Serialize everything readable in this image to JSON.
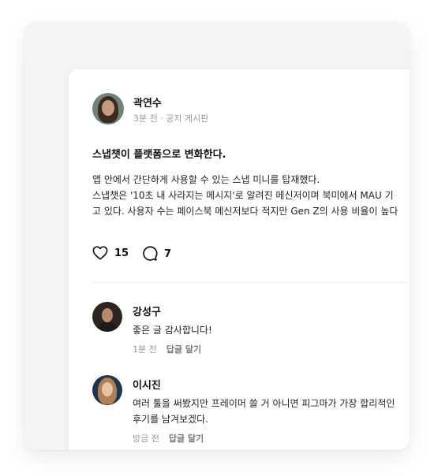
{
  "post": {
    "author": "곽연수",
    "meta": "3분 전 · 공지 게시판",
    "title": "스냅챗이 플랫폼으로 변화한다.",
    "body_lines": [
      "앱 안에서 간단하게 사용할 수 있는 스냅 미니를 탑재했다.",
      "스냅챗은 '10초 내 사라지는 메시지'로 알려진 메신저이며 북미에서 MAU 기",
      "고 있다. 사용자 수는 페이스북 메신저보다 적지만 Gen Z의 사용 비율이 높다"
    ],
    "likes": "15",
    "comments_count": "7"
  },
  "comments": [
    {
      "name": "강성구",
      "lines": [
        "좋은 글 감사합니다!"
      ],
      "time": "1분 전",
      "reply": "답글 달기"
    },
    {
      "name": "이시진",
      "lines": [
        "여러 툴을 써봤지만 프레이머 쓸 거 아니면 피그마가 가장 합리적인",
        "후기를 남겨보겠다."
      ],
      "time": "방금 전",
      "reply": "답글 달기"
    }
  ],
  "icons": {
    "like": "heart-icon",
    "comment": "comment-bubble-icon"
  }
}
